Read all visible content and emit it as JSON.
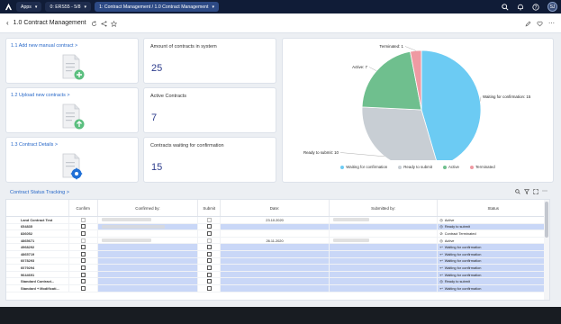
{
  "topbar": {
    "apps": "Apps",
    "system": "0: ERS55 - 5/8",
    "tab": "1: Contract Management / 1.0 Contract Management",
    "avatar": "SJ"
  },
  "header": {
    "title": "1.0 Contract Management"
  },
  "cards": {
    "add_link": "1.1 Add new manual contract >",
    "upload_link": "1.2 Upload new contracts >",
    "details_link": "1.3 Contract Details >",
    "kpi1": {
      "title": "Amount of contracts in system",
      "value": "25"
    },
    "kpi2": {
      "title": "Active Contracts",
      "value": "7"
    },
    "kpi3": {
      "title": "Contracts waiting for confirmation",
      "value": "15"
    }
  },
  "chart_data": {
    "type": "pie",
    "slices": [
      {
        "name": "Waiting for confirmation",
        "value": 15,
        "label": "Waiting for confirmation: 15",
        "color": "#6ccbf3"
      },
      {
        "name": "Ready to submit",
        "value": 10,
        "label": "Ready to submit: 10",
        "color": "#c8ced4"
      },
      {
        "name": "Active",
        "value": 7,
        "label": "Active: 7",
        "color": "#6fbf8e"
      },
      {
        "name": "Terminated",
        "value": 1,
        "label": "Terminated: 1",
        "color": "#ef9aa3"
      }
    ],
    "legend_position": "bottom"
  },
  "table": {
    "title": "Contract Status Tracking >",
    "headers": [
      "",
      "Confirm",
      "Confirmed by:",
      "Submit",
      "Date:",
      "Submitted by:",
      "Status"
    ],
    "rows": [
      {
        "name": "Land Contract Test",
        "date": "23.10.2020",
        "status": "Active",
        "icon": "◎",
        "hl": false
      },
      {
        "name": "654835",
        "date": "",
        "status": "Ready to submit",
        "icon": "◎",
        "hl": true
      },
      {
        "name": "836052",
        "date": "",
        "status": "Contract Terminated",
        "icon": "⊘",
        "hl": false
      },
      {
        "name": "4865671",
        "date": "26.11.2020",
        "status": "Active",
        "icon": "◎",
        "hl": false
      },
      {
        "name": "4968292",
        "date": "",
        "status": "Waiting for confirmation",
        "icon": "↩",
        "hl": true
      },
      {
        "name": "4865719",
        "date": "",
        "status": "Waiting for confirmation",
        "icon": "↩",
        "hl": true
      },
      {
        "name": "6078293",
        "date": "",
        "status": "Waiting for confirmation",
        "icon": "↩",
        "hl": true
      },
      {
        "name": "6079294",
        "date": "",
        "status": "Waiting for confirmation",
        "icon": "↩",
        "hl": true
      },
      {
        "name": "9644691",
        "date": "",
        "status": "Waiting for confirmation",
        "icon": "↩",
        "hl": true
      },
      {
        "name": "Standard Contract...",
        "date": "",
        "status": "Ready to submit",
        "icon": "◎",
        "hl": true
      },
      {
        "name": "Standard + Modificati...",
        "date": "",
        "status": "Waiting for confirmation",
        "icon": "↩",
        "hl": true
      }
    ]
  }
}
